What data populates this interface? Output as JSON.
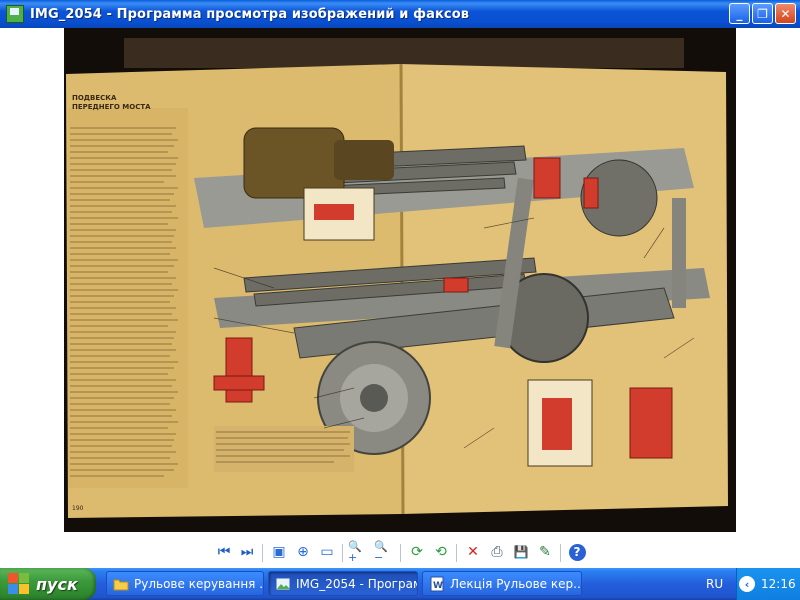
{
  "window": {
    "title": "IMG_2054 - Программа просмотра изображений и факсов",
    "minimize": "_",
    "maximize": "❐",
    "close": "✕"
  },
  "photo": {
    "heading_line1": "ПОДВЕСКА",
    "heading_line2": "ПЕРЕДНЕГО МОСТА",
    "page_number": "190"
  },
  "toolbar": {
    "prev_image": "⏮",
    "next_image": "⏭",
    "best_fit": "▣",
    "actual_size": "⊕",
    "slideshow": "▭",
    "zoom_in": "🔍+",
    "zoom_out": "🔍−",
    "rotate_cw": "⟳",
    "rotate_ccw": "⟲",
    "delete": "✕",
    "print": "⎙",
    "save": "💾",
    "edit": "✎",
    "help": "?"
  },
  "taskbar": {
    "start_label": "пуск",
    "tasks": [
      {
        "label": "Рульове керування ..."
      },
      {
        "label": "IMG_2054 - Програм..."
      },
      {
        "label": "Лекція Рульове кер..."
      }
    ],
    "language": "RU",
    "clock": "12:16",
    "tray_arrow": "‹"
  },
  "colors": {
    "titlebar": "#0a4fd0",
    "taskbar": "#245edb",
    "start": "#3c9a3c",
    "tray": "#0f7fe0",
    "page": "#d9b66a",
    "red": "#d23c2c"
  }
}
